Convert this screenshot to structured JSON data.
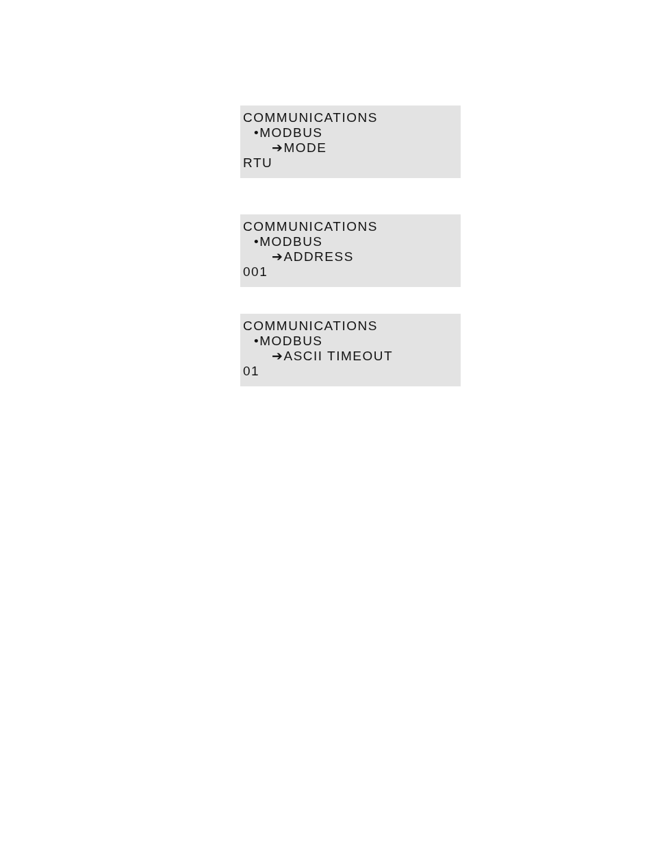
{
  "screens": [
    {
      "title": "COMMUNICATIONS",
      "menu": "•MODBUS",
      "item": "➔MODE",
      "value": "RTU"
    },
    {
      "title": "COMMUNICATIONS",
      "menu": "•MODBUS",
      "item": "➔ADDRESS",
      "value": "001"
    },
    {
      "title": "COMMUNICATIONS",
      "menu": "•MODBUS",
      "item": "➔ASCII TIMEOUT",
      "value": "01"
    }
  ]
}
